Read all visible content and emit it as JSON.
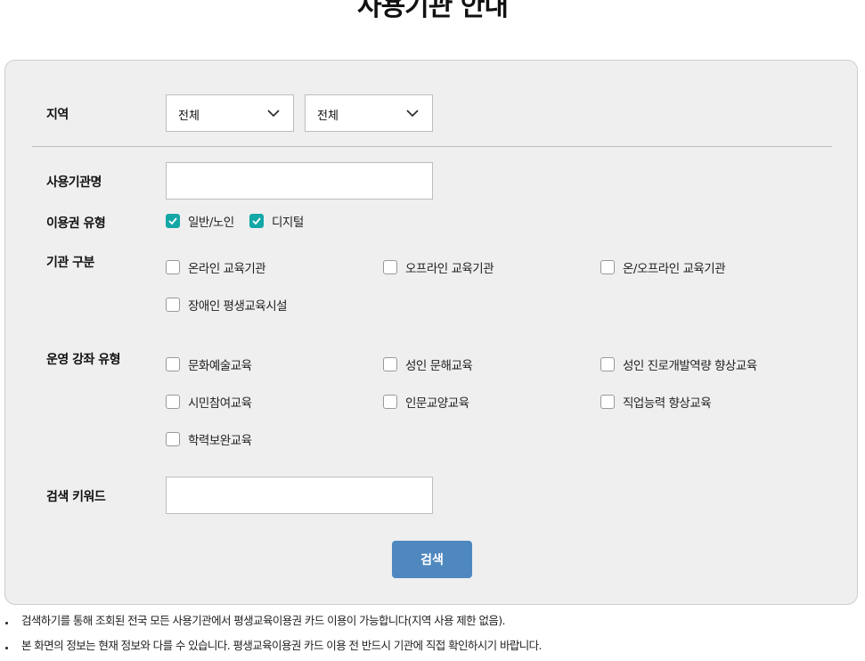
{
  "page_title": "사용기관 안내",
  "filters": {
    "region": {
      "label": "지역",
      "select1": "전체",
      "select2": "전체"
    },
    "institution_name": {
      "label": "사용기관명",
      "value": ""
    },
    "voucher_type": {
      "label": "이용권 유형",
      "options": [
        {
          "label": "일반/노인",
          "checked": true
        },
        {
          "label": "디지털",
          "checked": true
        }
      ]
    },
    "institution_category": {
      "label": "기관 구분",
      "options": [
        {
          "label": "온라인 교육기관",
          "checked": false
        },
        {
          "label": "오프라인 교육기관",
          "checked": false
        },
        {
          "label": "온/오프라인 교육기관",
          "checked": false
        },
        {
          "label": "장애인 평생교육시설",
          "checked": false
        }
      ]
    },
    "course_type": {
      "label": "운영 강좌 유형",
      "options": [
        {
          "label": "문화예술교육",
          "checked": false
        },
        {
          "label": "성인 문해교육",
          "checked": false
        },
        {
          "label": "성인 진로개발역량 향상교육",
          "checked": false
        },
        {
          "label": "시민참여교육",
          "checked": false
        },
        {
          "label": "인문교양교육",
          "checked": false
        },
        {
          "label": "직업능력 향상교육",
          "checked": false
        },
        {
          "label": "학력보완교육",
          "checked": false
        }
      ]
    },
    "keyword": {
      "label": "검색 키워드",
      "value": ""
    }
  },
  "search_button": "검색",
  "notes": [
    "검색하기를 통해 조회된 전국 모든 사용기관에서 평생교육이용권 카드 이용이 가능합니다(지역 사용 제한 없음).",
    "본 화면의 정보는 현재 정보와 다를 수 있습니다. 평생교육이용권 카드 이용 전 반드시 기관에 직접 확인하시기 바랍니다."
  ],
  "colors": {
    "checkbox_checked": "#13a7a6",
    "search_button": "#4f88bf",
    "panel_bg": "#efefef"
  }
}
